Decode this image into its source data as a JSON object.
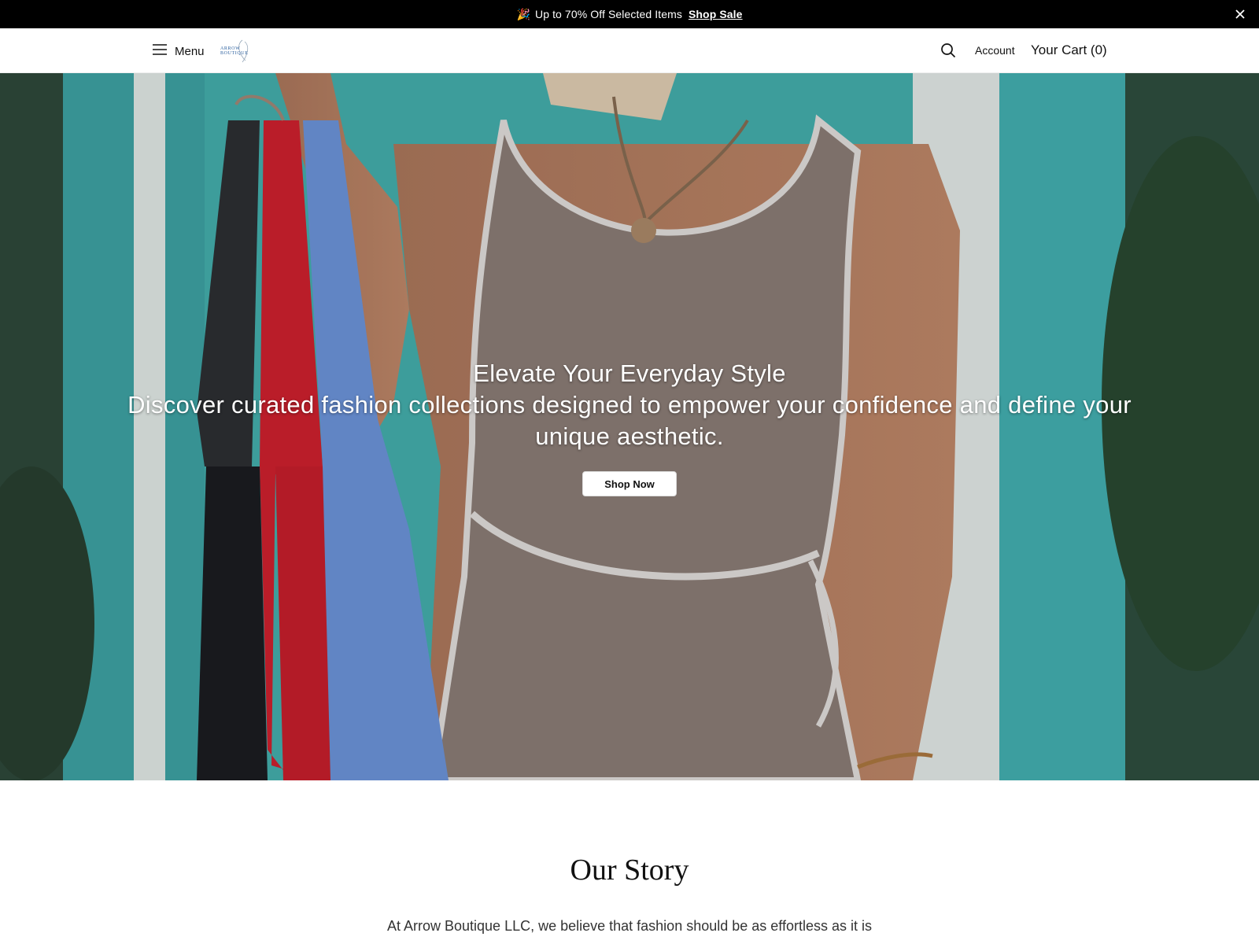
{
  "announcement": {
    "emoji": "🎉",
    "text": "Up to 70% Off Selected Items",
    "link_label": "Shop Sale",
    "close_icon": "close-icon"
  },
  "header": {
    "menu_label": "Menu",
    "logo_text": "ARROW BOUTIQUE",
    "account_label": "Account",
    "cart_label": "Your Cart (0)"
  },
  "hero": {
    "title": "Elevate Your Everyday Style",
    "subtitle": "Discover curated fashion collections designed to empower your confidence and define your unique aesthetic.",
    "cta_label": "Shop Now"
  },
  "story": {
    "title": "Our Story",
    "body": "At Arrow Boutique LLC, we believe that fashion should be as effortless as it is"
  },
  "colors": {
    "announcement_bg": "#000000",
    "accent_teal": "#3fb7b8",
    "dress": "#8f8079",
    "logo_blue": "#2a5f9e"
  }
}
